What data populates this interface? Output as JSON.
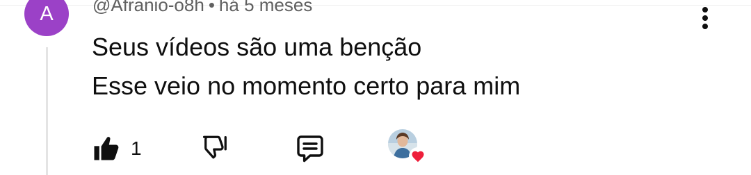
{
  "author": {
    "avatar_letter": "A",
    "avatar_color": "#9b41c7",
    "handle": "@Afranio-o8h",
    "separator": "•",
    "time": "há 5 meses"
  },
  "comment": {
    "line1": "Seus vídeos são uma benção",
    "line2": "Esse veio no momento certo para mim"
  },
  "actions": {
    "like_icon": "thumbs-up-filled-icon",
    "like_count": "1",
    "dislike_icon": "thumbs-down-icon",
    "reply_icon": "reply-comment-icon",
    "more_icon": "more-vert-icon",
    "creator_heart_icon": "creator-heart-icon",
    "heart_color": "#ee1f3b"
  }
}
